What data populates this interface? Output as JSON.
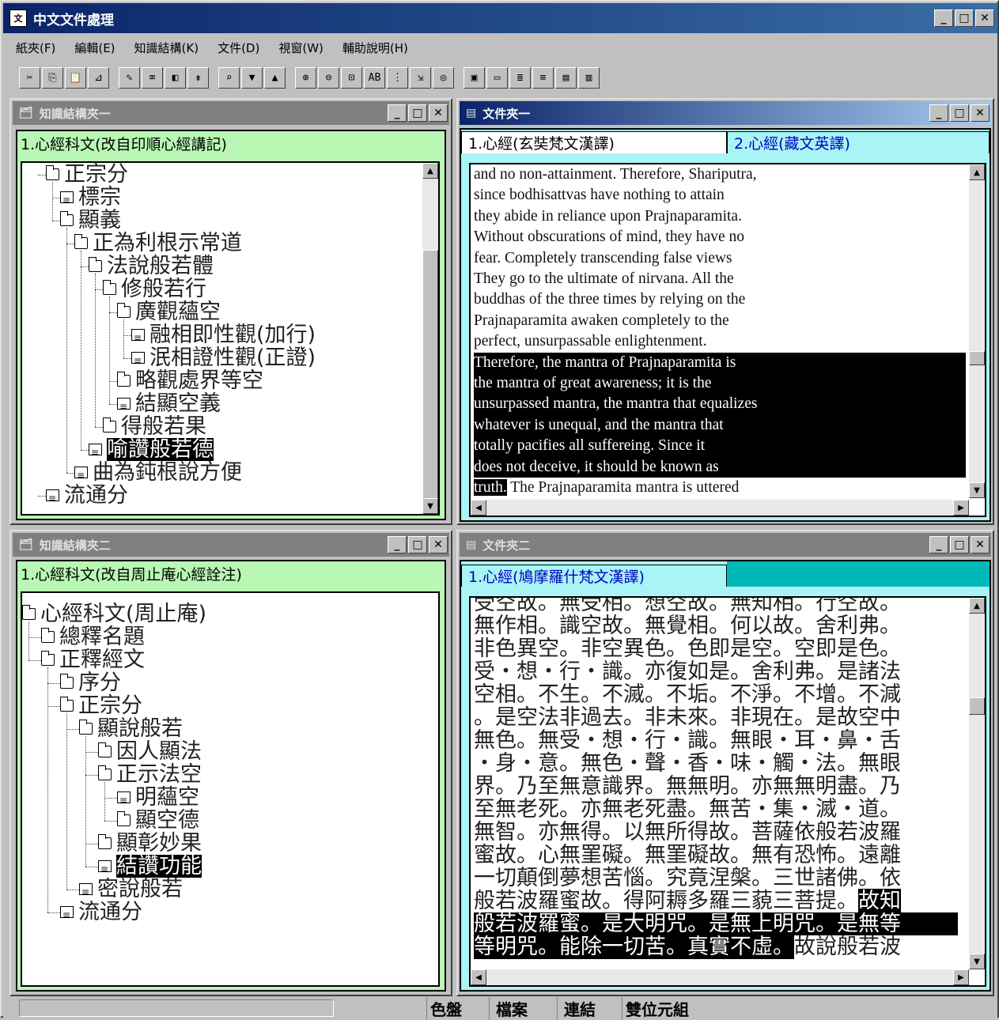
{
  "app": {
    "title": "中文文件處理"
  },
  "menu": [
    "紙夾(F)",
    "編輯(E)",
    "知識結構(K)",
    "文件(D)",
    "視窗(W)",
    "輔助說明(H)"
  ],
  "toolbar": {
    "groups": [
      [
        "cut-icon",
        "copy-icon",
        "paste-icon",
        "chart-icon"
      ],
      [
        "pen-icon",
        "eraser-icon",
        "bucket-icon",
        "sort-icon"
      ],
      [
        "find-icon",
        "down-arrow-icon",
        "up-arrow-icon"
      ],
      [
        "zoom-in-icon",
        "zoom-out-icon",
        "zoom-fit-icon",
        "ab-icon",
        "tree-icon",
        "export-icon",
        "palette-icon"
      ],
      [
        "window-icon",
        "folder-icon",
        "tree1-icon",
        "tree2-icon",
        "doc1-icon",
        "doc2-icon"
      ]
    ]
  },
  "kpanel1": {
    "title": "知識結構夾一",
    "header": "1.心經科文(改自印順心經講記)",
    "nodes": [
      {
        "t": "正宗分",
        "type": "folder",
        "level": 1
      },
      {
        "t": "標宗",
        "type": "doc",
        "level": 2
      },
      {
        "t": "顯義",
        "type": "folder",
        "level": 2
      },
      {
        "t": "正為利根示常道",
        "type": "folder",
        "level": 3
      },
      {
        "t": "法說般若體",
        "type": "folder",
        "level": 4
      },
      {
        "t": "修般若行",
        "type": "folder",
        "level": 5
      },
      {
        "t": "廣觀蘊空",
        "type": "folder",
        "level": 6
      },
      {
        "t": "融相即性觀(加行)",
        "type": "doc",
        "level": 7
      },
      {
        "t": "泯相證性觀(正證)",
        "type": "doc",
        "level": 7
      },
      {
        "t": "略觀處界等空",
        "type": "folder",
        "level": 6
      },
      {
        "t": "結顯空義",
        "type": "doc",
        "level": 6
      },
      {
        "t": "得般若果",
        "type": "folder",
        "level": 5
      },
      {
        "t": "喻讚般若德",
        "type": "doc",
        "level": 4,
        "sel": true
      },
      {
        "t": "曲為鈍根說方便",
        "type": "doc",
        "level": 3
      },
      {
        "t": "流通分",
        "type": "doc",
        "level": 1
      }
    ]
  },
  "kpanel2": {
    "title": "知識結構夾二",
    "header": "1.心經科文(改自周止庵心經詮注)",
    "nodes": [
      {
        "t": "心經科文(周止庵)",
        "type": "folder",
        "level": 0
      },
      {
        "t": "總釋名題",
        "type": "folder",
        "level": 1
      },
      {
        "t": "正釋經文",
        "type": "folder",
        "level": 1
      },
      {
        "t": "序分",
        "type": "folder",
        "level": 2
      },
      {
        "t": "正宗分",
        "type": "folder",
        "level": 2
      },
      {
        "t": "顯說般若",
        "type": "folder",
        "level": 3
      },
      {
        "t": "因人顯法",
        "type": "folder",
        "level": 4
      },
      {
        "t": "正示法空",
        "type": "folder",
        "level": 4
      },
      {
        "t": "明蘊空",
        "type": "doc",
        "level": 5
      },
      {
        "t": "顯空德",
        "type": "folder",
        "level": 5
      },
      {
        "t": "顯彰妙果",
        "type": "folder",
        "level": 4
      },
      {
        "t": "結讚功能",
        "type": "doc",
        "level": 4,
        "sel": true
      },
      {
        "t": "密說般若",
        "type": "doc",
        "level": 3
      },
      {
        "t": "流通分",
        "type": "doc",
        "level": 2
      }
    ]
  },
  "dpanel1": {
    "title": "文件夾一",
    "tabs": [
      "1.心經(玄奘梵文漢譯)",
      "2.心經(藏文英譯)"
    ],
    "lines": [
      {
        "t": "and no non-attainment. Therefore, Shariputra,",
        "hl": false
      },
      {
        "t": "since bodhisattvas have nothing to attain",
        "hl": false
      },
      {
        "t": "they abide in reliance upon Prajnaparamita.",
        "hl": false
      },
      {
        "t": "Without obscurations of mind, they have no",
        "hl": false
      },
      {
        "t": "fear. Completely transcending false views",
        "hl": false
      },
      {
        "t": "They go to the ultimate of nirvana. All the",
        "hl": false
      },
      {
        "t": "buddhas of the three times by relying on the",
        "hl": false
      },
      {
        "t": "Prajnaparamita awaken completely to the",
        "hl": false
      },
      {
        "t": "perfect, unsurpassable enlightenment.",
        "hl": false
      },
      {
        "t": "Therefore, the mantra of Prajnaparamita is",
        "hl": true
      },
      {
        "t": "the mantra of great awareness; it is the",
        "hl": true
      },
      {
        "t": "unsurpassed mantra, the mantra that equalizes",
        "hl": true
      },
      {
        "t": "whatever is unequal, and the mantra that",
        "hl": true
      },
      {
        "t": "totally pacifies all suffereing. Since it",
        "hl": true
      },
      {
        "t": "does not deceive, it should be known as",
        "hl": true
      }
    ],
    "last_hl": "truth.",
    "last_rest": " The Prajnaparamita mantra is uttered"
  },
  "dpanel2": {
    "title": "文件夾二",
    "tabs": [
      "1.心經(鳩摩羅什梵文漢譯)"
    ],
    "lines": [
      "受空故。無受相。想空故。無知相。行空故。",
      "無作相。識空故。無覺相。何以故。舍利弗。",
      "非色異空。非空異色。色即是空。空即是色。",
      "受・想・行・識。亦復如是。舍利弗。是諸法",
      "空相。不生。不滅。不垢。不淨。不增。不減",
      "。是空法非過去。非未來。非現在。是故空中",
      "無色。無受・想・行・識。無眼・耳・鼻・舌",
      "・身・意。無色・聲・香・味・觸・法。無眼",
      "界。乃至無意識界。無無明。亦無無明盡。乃",
      "至無老死。亦無老死盡。無苦・集・滅・道。",
      "無智。亦無得。以無所得故。菩薩依般若波羅",
      "蜜故。心無罣礙。無罣礙故。無有恐怖。遠離",
      "一切顛倒夢想苦惱。究竟涅槃。三世諸佛。依"
    ],
    "line14_plain": "般若波羅蜜故。得阿耨多羅三藐三菩提。",
    "line14_hl": "故知",
    "line15_hl": "般若波羅蜜。是大明咒。是無上明咒。是無等",
    "line16_hl": "等明咒。能除一切苦。真實不虛。",
    "line16_plain": "故說般若波"
  },
  "status": {
    "items": [
      "色盤",
      "檔案",
      "連結",
      "雙位元組"
    ]
  }
}
